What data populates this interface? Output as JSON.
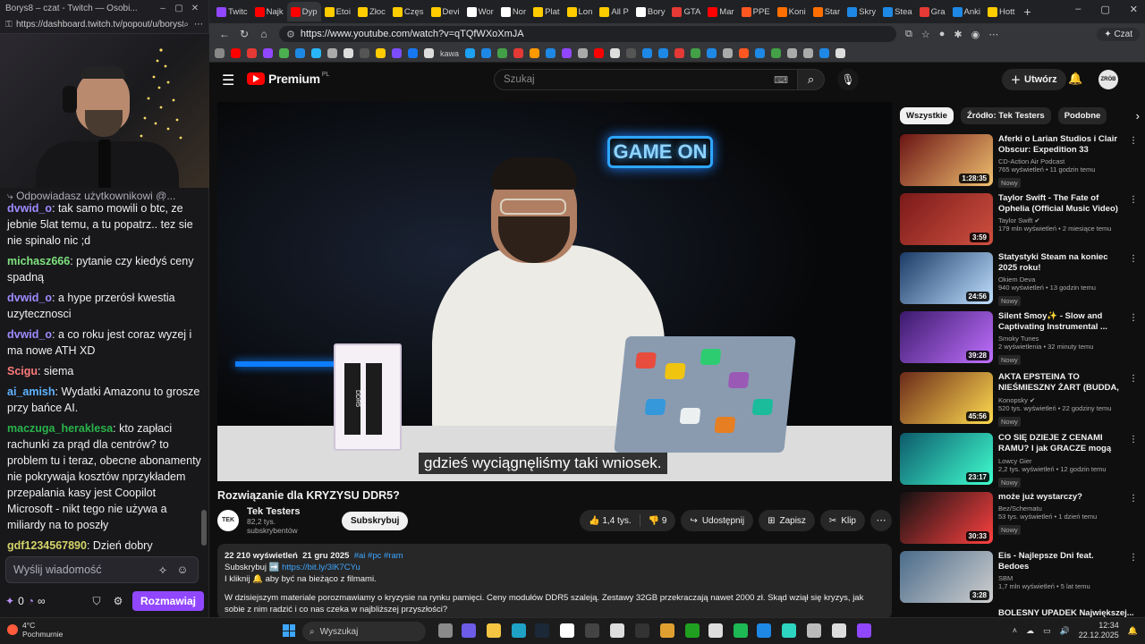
{
  "twitch": {
    "window_title": "Borys8 – czat - Twitch — Osobi...",
    "url": "https://dashboard.twitch.tv/popout/u/borys8/...",
    "reply_hint": "Odpowiadasz użytkownikowi @...",
    "messages": [
      {
        "user": "dvwid_o",
        "color": "#9e8cff",
        "text": ": tak samo mowili o btc, ze jebnie 5lat temu, a tu popatrz.. tez sie nie spinalo nic ;d"
      },
      {
        "user": "michasz666",
        "color": "#7ee37e",
        "text": ": pytanie czy kiedyś ceny spadną"
      },
      {
        "user": "dvwid_o",
        "color": "#9e8cff",
        "text": ": a hype przerósł kwestia uzytecznosci"
      },
      {
        "user": "dvwid_o",
        "color": "#9e8cff",
        "text": ": a co roku jest coraz wyzej i ma nowe ATH XD"
      },
      {
        "user": "Scigu",
        "color": "#ff7a7a",
        "text": ": siema"
      },
      {
        "user": "ai_amish",
        "color": "#5fb3ff",
        "text": ": Wydatki Amazonu to grosze przy bańce AI."
      },
      {
        "user": "maczuga_heraklesa",
        "color": "#29b34a",
        "text": ": kto zapłaci rachunki za prąd dla centrów? to problem tu i teraz, obecne abonamenty nie pokrywaja kosztów nprzykładem przepalania kasy jest Coopilot Microsoft - nikt tego nie używa a miliardy na to poszły"
      },
      {
        "user": "gdf1234567890",
        "color": "#d4d46a",
        "text": ": Dzień dobry"
      }
    ],
    "input_placeholder": "Wyślij wiadomość",
    "points": "0",
    "send_label": "Rozmawiaj"
  },
  "browser": {
    "tabs": [
      "Twitc",
      "Najk",
      "Dyp",
      "Etoi",
      "Złoc",
      "Częs",
      "Devi",
      "Wor",
      "Nor",
      "Plat",
      "Lon",
      "All P",
      "Bory",
      "GTA",
      "Mar",
      "PPE",
      "Koni",
      "Star",
      "Skry",
      "Stea",
      "Gra",
      "Anki",
      "Hott"
    ],
    "url": "https://www.youtube.com/watch?v=qTQfWXoXmJA",
    "czat_label": "Czat",
    "bookmark_label": "kawa"
  },
  "youtube": {
    "logo_text": "Premium",
    "logo_region": "PL",
    "search_placeholder": "Szukaj",
    "create_label": "Utwórz",
    "avatar_text": "ZRÓB TO",
    "player": {
      "neon_text": "GAME ON",
      "ram_label": "DDR5",
      "subtitle": "gdzieś wyciągnęliśmy taki wniosek."
    },
    "video_title": "Rozwiązanie dla KRYZYSU DDR5?",
    "channel": {
      "avatar": "TEK",
      "name": "Tek Testers",
      "subs": "82,2 tys. subskrybentów",
      "subscribe_label": "Subskrybuj"
    },
    "actions": {
      "likes": "1,4 tys.",
      "dislikes": "9",
      "share": "Udostępnij",
      "save": "Zapisz",
      "clip": "Klip"
    },
    "description": {
      "views": "22 210 wyświetleń",
      "date": "21 gru 2025",
      "tags": "#ai #pc #ram",
      "line1_prefix": "Subskrybuj ➡️ ",
      "line1_link": "https://bit.ly/3lK7CYu",
      "line2": "I kliknij 🔔 aby być na bieżąco z filmami.",
      "body": "W dzisiejszym materiale porozmawiamy o kryzysie na rynku pamięci. Ceny modułów DDR5 szaleją. Zestawy 32GB przekraczają nawet 2000 zł. Skąd wziął się kryzys, jak sobie z nim radzić i co nas czeka w najbliższej przyszłości?"
    },
    "chips": [
      "Wszystkie",
      "Źródło: Tek Testers",
      "Podobne"
    ],
    "recommendations": [
      {
        "title": "Aferki o Larian Studios i Clair Obscur: Expedition 33",
        "channel": "CD-Action Air Podcast",
        "views": "765 wyświetleń • 11 godzin temu",
        "badge": "Nowy",
        "duration": "1:28:35",
        "c1": "#6b1414",
        "c2": "#f0c070"
      },
      {
        "title": "Taylor Swift - The Fate of Ophelia (Official Music Video)",
        "channel": "Taylor Swift ✔",
        "views": "179 mln wyświetleń • 2 miesiące temu",
        "badge": "",
        "duration": "3:59",
        "c1": "#7a1a1a",
        "c2": "#d05040"
      },
      {
        "title": "Statystyki Steam na koniec 2025 roku!",
        "channel": "Okiem Deva",
        "views": "940 wyświetleń • 13 godzin temu",
        "badge": "Nowy",
        "duration": "24:56",
        "c1": "#1b3a66",
        "c2": "#c0e0ff"
      },
      {
        "title": "Silent Smoy✨ - Slow and Captivating Instrumental ...",
        "channel": "Smoky Tunes",
        "views": "2 wyświetlenia • 32 minuty temu",
        "badge": "Nowy",
        "duration": "39:28",
        "c1": "#3b1a6b",
        "c2": "#c070ff"
      },
      {
        "title": "AKTA EPSTEINA TO NIEŚMIESZNY ŻART (BUDDA, ...",
        "channel": "Konopsky ✔",
        "views": "520 tys. wyświetleń • 22 godziny temu",
        "badge": "Nowy",
        "duration": "45:56",
        "c1": "#6b2a1a",
        "c2": "#ffdc50"
      },
      {
        "title": "CO SIĘ DZIEJE Z CENAMI RAMU? I jak GRACZE mogą ...",
        "channel": "Lowcy Gier",
        "views": "2,2 tys. wyświetleń • 12 godzin temu",
        "badge": "Nowy",
        "duration": "23:17",
        "c1": "#0d5a6b",
        "c2": "#40ffd0"
      },
      {
        "title": "może już wystarczy?",
        "channel": "Bez/Schematu",
        "views": "53 tys. wyświetleń • 1 dzień temu",
        "badge": "Nowy",
        "duration": "30:33",
        "c1": "#111111",
        "c2": "#ff4040"
      },
      {
        "title": "Eis - Najlepsze Dni feat. Bedoes",
        "channel": "SBM",
        "views": "1,7 mln wyświetleń • 5 lat temu",
        "badge": "",
        "duration": "3:28",
        "c1": "#4a6b8a",
        "c2": "#d0d0d0"
      }
    ],
    "next_title_partial": "BOLESNY UPADEK Największej..."
  },
  "taskbar": {
    "temp": "4°C",
    "weather": "Pochmurnie",
    "search_label": "Wyszukaj",
    "time": "12:34",
    "date": "22.12.2025"
  }
}
